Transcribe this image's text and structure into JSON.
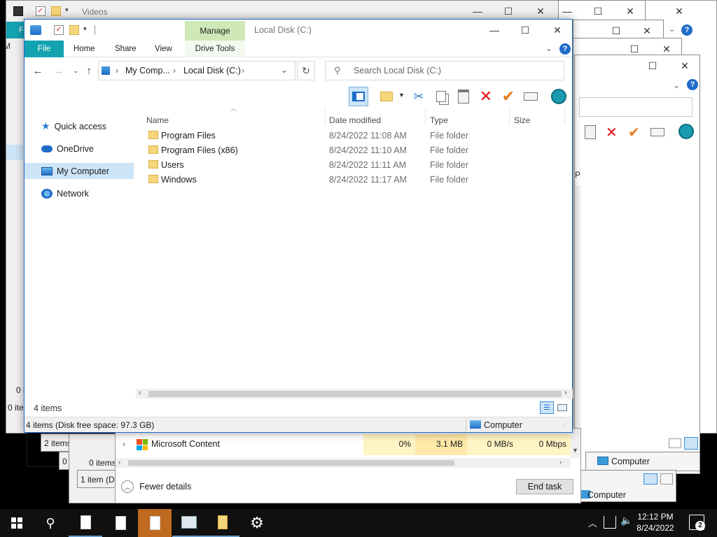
{
  "colors": {
    "accent": "#0078d4",
    "file_tab": "#13a2b0",
    "manage_tab": "#cfe8b8",
    "selected": "#cce4f7",
    "perf": "#fff4c4"
  },
  "bg_windows": {
    "videos_title": "Videos",
    "frag_items_1": "0 i",
    "frag_items_2": "0 ite",
    "frag_items_3": "2 items (D",
    "frag_items_4": "0 ite",
    "frag_items_5": "0 items",
    "frag_items_6": "1 item (D",
    "frag_p": "P",
    "frag_m": "M",
    "frag_f": "F",
    "computer_label_1": "Computer",
    "computer_label_2": "Computer"
  },
  "task_manager": {
    "row": {
      "name": "Microsoft Content",
      "cpu": "0%",
      "memory": "3.1 MB",
      "disk": "0 MB/s",
      "network": "0 Mbps"
    },
    "fewer_details": "Fewer details",
    "end_task": "End task"
  },
  "explorer": {
    "title": "Local Disk (C:)",
    "manage_tab": "Manage",
    "ribbon_tabs": [
      "File",
      "Home",
      "Share",
      "View",
      "Drive Tools"
    ],
    "breadcrumb": [
      "My Comp...",
      "Local Disk (C:)"
    ],
    "search_placeholder": "Search Local Disk (C:)",
    "sidebar": [
      {
        "label": "Quick access",
        "icon": "star-icon"
      },
      {
        "label": "OneDrive",
        "icon": "cloud-icon"
      },
      {
        "label": "My Computer",
        "icon": "computer-icon",
        "selected": true
      },
      {
        "label": "Network",
        "icon": "network-icon"
      }
    ],
    "columns": [
      "Name",
      "Date modified",
      "Type",
      "Size"
    ],
    "files": [
      {
        "name": "Program Files",
        "date": "8/24/2022 11:08 AM",
        "type": "File folder"
      },
      {
        "name": "Program Files (x86)",
        "date": "8/24/2022 11:10 AM",
        "type": "File folder"
      },
      {
        "name": "Users",
        "date": "8/24/2022 11:11 AM",
        "type": "File folder"
      },
      {
        "name": "Windows",
        "date": "8/24/2022 11:17 AM",
        "type": "File folder"
      }
    ],
    "item_count": "4 items",
    "status_text": "4 items (Disk free space: 97.3 GB)",
    "status_computer": "Computer"
  },
  "taskbar": {
    "time": "12:12 PM",
    "date": "8/24/2022",
    "notifications": "2"
  }
}
